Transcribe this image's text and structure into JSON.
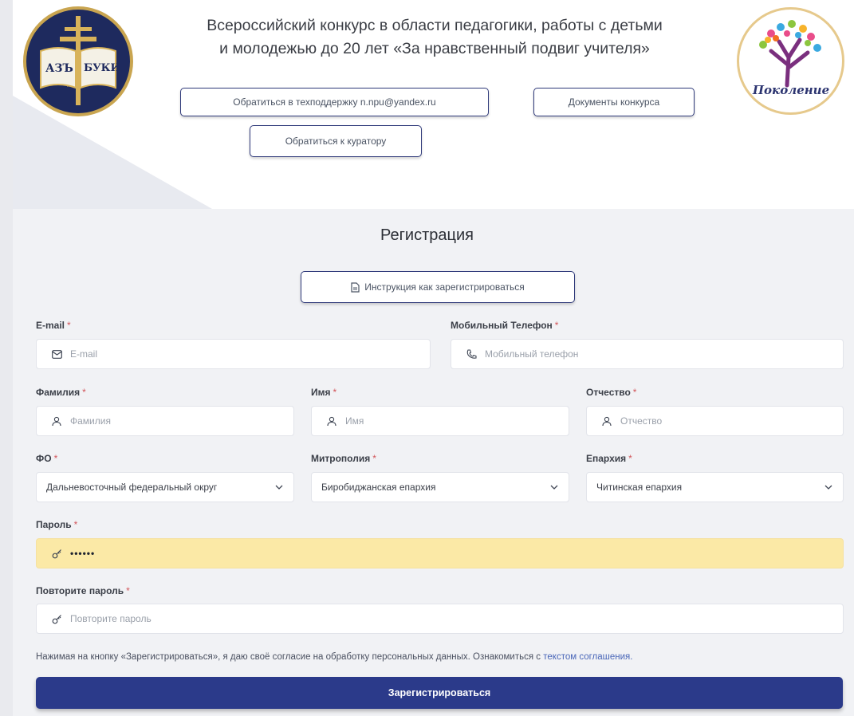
{
  "header": {
    "title_line1": "Всероссийский конкурс в области педагогики, работы с детьми",
    "title_line2": "и молодежью до 20 лет «За нравственный подвиг учителя»",
    "support_button": "Обратиться в техподдержку n.npu@yandex.ru",
    "docs_button": "Документы конкурса",
    "curator_button": "Обратиться к куратору",
    "logo_left_letters": [
      "АЗЪ",
      "БУКИ"
    ],
    "logo_right_text": "Поколение"
  },
  "form": {
    "title": "Регистрация",
    "instruction_button": "Инструкция как зарегистрироваться",
    "required_mark": "*",
    "email": {
      "label": "E-mail",
      "placeholder": "E-mail"
    },
    "phone": {
      "label": "Мобильный Телефон",
      "placeholder": "Мобильный телефон"
    },
    "lastname": {
      "label": "Фамилия",
      "placeholder": "Фамилия"
    },
    "firstname": {
      "label": "Имя",
      "placeholder": "Имя"
    },
    "patronymic": {
      "label": "Отчество",
      "placeholder": "Отчество"
    },
    "fo": {
      "label": "ФО",
      "value": "Дальневосточный федеральный округ"
    },
    "metropolis": {
      "label": "Митрополия",
      "value": "Биробиджанская епархия"
    },
    "eparchy": {
      "label": "Епархия",
      "value": "Читинская епархия"
    },
    "password": {
      "label": "Пароль",
      "value": "••••••"
    },
    "password_repeat": {
      "label": "Повторите пароль",
      "placeholder": "Повторите пароль"
    },
    "consent_text": "Нажимая на кнопку «Зарегистрироваться», я даю своё согласие на обработку персональных данных. Ознакомиться с",
    "consent_link": "текстом соглашения.",
    "submit": "Зарегистрироваться"
  },
  "colors": {
    "primary": "#2b3a8a",
    "required": "#d2555a",
    "autofill": "#fbe9a6",
    "link": "#4966b8"
  }
}
